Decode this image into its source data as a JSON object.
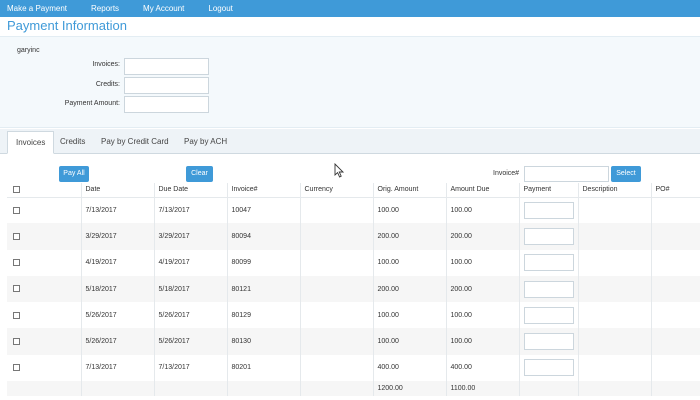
{
  "nav": {
    "items": [
      "Make a Payment",
      "Reports",
      "My Account",
      "Logout"
    ]
  },
  "page": {
    "title": "Payment Information"
  },
  "form": {
    "customer": "garyinc",
    "invoices_label": "Invoices:",
    "credits_label": "Credits:",
    "payment_amount_label": "Payment Amount:"
  },
  "tabs": [
    "Invoices",
    "Credits",
    "Pay by Credit Card",
    "Pay by ACH"
  ],
  "toolbar": {
    "pay_all_label": "Pay All",
    "clear_label": "Clear",
    "invoice_search_label": "Invoice#",
    "select_label": "Select"
  },
  "table": {
    "headers": [
      "",
      "Date",
      "Due Date",
      "Invoice#",
      "Currency",
      "Orig. Amount",
      "Amount Due",
      "Payment",
      "Description",
      "PO#"
    ],
    "rows": [
      {
        "date": "7/13/2017",
        "due": "7/13/2017",
        "invoice": "10047",
        "currency": "",
        "orig": "100.00",
        "due_amt": "100.00"
      },
      {
        "date": "3/29/2017",
        "due": "3/29/2017",
        "invoice": "80094",
        "currency": "",
        "orig": "200.00",
        "due_amt": "200.00"
      },
      {
        "date": "4/19/2017",
        "due": "4/19/2017",
        "invoice": "80099",
        "currency": "",
        "orig": "100.00",
        "due_amt": "100.00"
      },
      {
        "date": "5/18/2017",
        "due": "5/18/2017",
        "invoice": "80121",
        "currency": "",
        "orig": "200.00",
        "due_amt": "200.00"
      },
      {
        "date": "5/26/2017",
        "due": "5/26/2017",
        "invoice": "80129",
        "currency": "",
        "orig": "100.00",
        "due_amt": "100.00"
      },
      {
        "date": "5/26/2017",
        "due": "5/26/2017",
        "invoice": "80130",
        "currency": "",
        "orig": "100.00",
        "due_amt": "100.00"
      },
      {
        "date": "7/13/2017",
        "due": "7/13/2017",
        "invoice": "80201",
        "currency": "",
        "orig": "400.00",
        "due_amt": "400.00"
      }
    ],
    "totals": {
      "orig": "1200.00",
      "due": "1100.00"
    }
  },
  "colors": {
    "accent": "#3f9ad8",
    "panel": "#f4f9fc"
  }
}
